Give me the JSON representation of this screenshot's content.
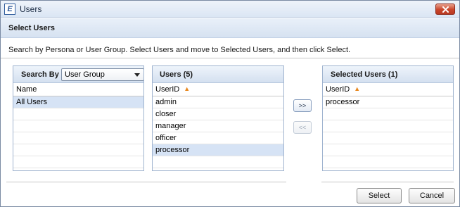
{
  "window": {
    "title": "Users",
    "app_icon_letter": "E"
  },
  "header": {
    "title": "Select Users"
  },
  "instructions": "Search by Persona or User Group.  Select Users and move to Selected Users, and then click Select.",
  "search_panel": {
    "label": "Search By",
    "dropdown_value": "User Group",
    "column_header": "Name",
    "rows": [
      "All Users",
      "",
      "",
      "",
      "",
      ""
    ]
  },
  "users_panel": {
    "title": "Users (5)",
    "column_header": "UserID",
    "rows": [
      "admin",
      "closer",
      "manager",
      "officer",
      "processor",
      ""
    ],
    "selected_row": "processor"
  },
  "selected_panel": {
    "title": "Selected Users (1)",
    "column_header": "UserID",
    "rows": [
      "processor",
      "",
      "",
      "",
      "",
      ""
    ]
  },
  "move_buttons": {
    "add_label": ">>",
    "remove_label": "<<"
  },
  "footer": {
    "select_label": "Select",
    "cancel_label": "Cancel"
  },
  "colors": {
    "selection": "#d6e3f5",
    "sort_arrow": "#e8861b",
    "close_button": "#c9452b"
  },
  "icons": {
    "sort": "sort-ascending-icon",
    "close": "close-icon",
    "dropdown": "chevron-down-icon"
  }
}
